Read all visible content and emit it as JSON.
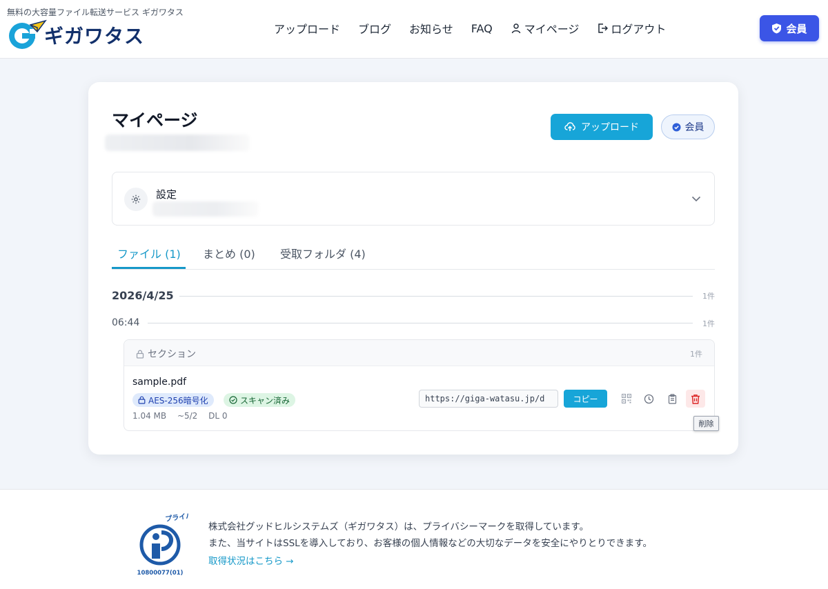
{
  "header": {
    "tagline": "無料の大容量ファイル転送サービス ギガワタス",
    "logo_text": "ギガワタス",
    "nav": [
      {
        "label": "アップロード"
      },
      {
        "label": "ブログ"
      },
      {
        "label": "お知らせ"
      },
      {
        "label": "FAQ"
      },
      {
        "label": "マイページ"
      },
      {
        "label": "ログアウト"
      }
    ],
    "member_button": "会員"
  },
  "main": {
    "title": "マイページ",
    "upload_button": "アップロード",
    "member_badge": "会員",
    "settings_label": "設定",
    "tabs": [
      {
        "label": "ファイル (1)",
        "active": true
      },
      {
        "label": "まとめ (0)",
        "active": false
      },
      {
        "label": "受取フォルダ (4)",
        "active": false
      }
    ],
    "date_group": {
      "date": "2026/4/25",
      "count": "1件"
    },
    "time_group": {
      "time": "06:44",
      "count": "1件"
    },
    "section": {
      "title": "セクション",
      "count": "1件",
      "file": {
        "name": "sample.pdf",
        "badge_encryption": "AES-256暗号化",
        "badge_scan": "スキャン済み",
        "size": "1.04 MB",
        "expiry": "~5/2",
        "downloads": "DL 0",
        "url": "https://giga-watasu.jp/d",
        "copy_button": "コピー",
        "delete_tooltip": "削除"
      }
    }
  },
  "footer": {
    "line1": "株式会社グッドヒルシステムズ（ギガワタス）は、プライバシーマークを取得しています。",
    "line2": "また、当サイトはSSLを導入しており、お客様の個人情報などの大切なデータを安全にやりとりできます。",
    "link": "取得状況はこちら →",
    "pmark_number": "10800077(01)",
    "pmark_text": "プライバシー"
  },
  "colors": {
    "accent": "#17a5d8",
    "member_blue": "#3b55e6",
    "delete_red": "#dc2626"
  }
}
